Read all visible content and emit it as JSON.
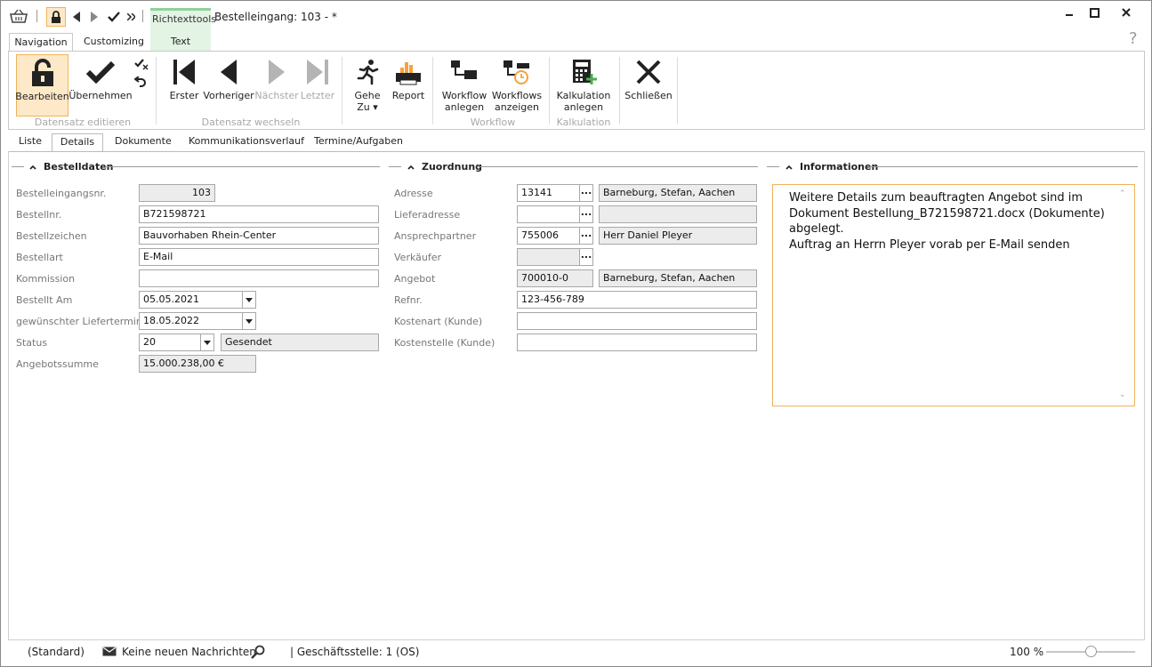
{
  "window": {
    "context_group": "Richtexttools",
    "title": "Bestelleingang: 103 -  *"
  },
  "ribbon_tabs": [
    {
      "label": "Navigation"
    },
    {
      "label": "Customizing"
    },
    {
      "label": "Text"
    }
  ],
  "help_label": "?",
  "ribbon": {
    "buttons": {
      "bearbeiten": "Bearbeiten",
      "uebernehmen": "Übernehmen",
      "erster": "Erster",
      "vorheriger": "Vorheriger",
      "naechster": "Nächster",
      "letzter": "Letzter",
      "gehe_zu_1": "Gehe",
      "gehe_zu_2": "Zu ▾",
      "report": "Report",
      "wf_anlegen_1": "Workflow",
      "wf_anlegen_2": "anlegen",
      "wf_anzeigen_1": "Workflows",
      "wf_anzeigen_2": "anzeigen",
      "kalk_1": "Kalkulation",
      "kalk_2": "anlegen",
      "schliessen": "Schließen"
    },
    "groups": {
      "datensatz_editieren": "Datensatz editieren",
      "datensatz_wechseln": "Datensatz wechseln",
      "workflow": "Workflow",
      "kalkulation": "Kalkulation"
    }
  },
  "content_tabs": [
    {
      "label": "Liste"
    },
    {
      "label": "Details"
    },
    {
      "label": "Dokumente"
    },
    {
      "label": "Kommunikationsverlauf"
    },
    {
      "label": "Termine/Aufgaben"
    }
  ],
  "sections": {
    "bestelldaten": "Bestelldaten",
    "zuordnung": "Zuordnung",
    "informationen": "Informationen"
  },
  "bestelldaten": {
    "bestelleingangsnr": {
      "label": "Bestelleingangsnr.",
      "value": "103"
    },
    "bestellnr": {
      "label": "Bestellnr.",
      "value": "B721598721"
    },
    "bestellzeichen": {
      "label": "Bestellzeichen",
      "value": "Bauvorhaben Rhein-Center"
    },
    "bestellart": {
      "label": "Bestellart",
      "value": "E-Mail"
    },
    "kommission": {
      "label": "Kommission",
      "value": ""
    },
    "bestellt_am": {
      "label": "Bestellt Am",
      "value": "05.05.2021"
    },
    "liefertermin": {
      "label": "gewünschter Liefertermin",
      "value": "18.05.2022"
    },
    "status": {
      "label": "Status",
      "value": "20",
      "text": "Gesendet"
    },
    "angebotssumme": {
      "label": "Angebotssumme",
      "value": "15.000.238,00 €"
    }
  },
  "zuordnung": {
    "adresse": {
      "label": "Adresse",
      "value": "13141",
      "text": "Barneburg, Stefan, Aachen"
    },
    "lieferadresse": {
      "label": "Lieferadresse",
      "value": "",
      "text": ""
    },
    "ansprechpartner": {
      "label": "Ansprechpartner",
      "value": "755006",
      "text": "Herr Daniel Pleyer"
    },
    "verkaeufer": {
      "label": "Verkäufer",
      "value": ""
    },
    "angebot": {
      "label": "Angebot",
      "value": "700010-0",
      "text": "Barneburg, Stefan, Aachen"
    },
    "refnr": {
      "label": "Refnr.",
      "value": "123-456-789"
    },
    "kostenart": {
      "label": "Kostenart (Kunde)",
      "value": ""
    },
    "kostenstelle": {
      "label": "Kostenstelle (Kunde)",
      "value": ""
    }
  },
  "informationen": {
    "line1": "Weitere Details zum beauftragten Angebot sind im",
    "line2": "Dokument Bestellung_B721598721.docx (Dokumente)",
    "line3": "abgelegt.",
    "line4": "Auftrag an Herrn Pleyer vorab per E-Mail senden"
  },
  "statusbar": {
    "profile": "(Standard)",
    "messages": "Keine neuen Nachrichten",
    "branch": "| Geschäftsstelle:  1 (OS)",
    "zoom": "100 %",
    "zoom_level_percent": 50
  },
  "colors": {
    "accent_orange": "#f0b35a",
    "active_bg": "#fde8c7",
    "context_green": "#8fd19a",
    "readonly_bg": "#ececec"
  }
}
